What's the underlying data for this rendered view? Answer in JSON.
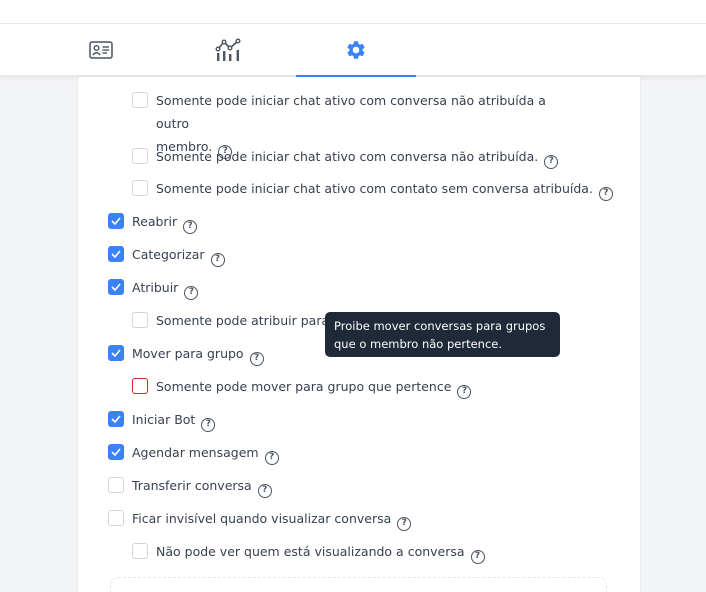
{
  "tabs": [
    {
      "icon": "contact-card-icon",
      "active": false
    },
    {
      "icon": "analytics-chart-icon",
      "active": false
    },
    {
      "icon": "gear-icon",
      "active": true
    }
  ],
  "colors": {
    "accent": "#3b82f6",
    "error": "#dc2626",
    "tooltip_bg": "#1f2937"
  },
  "permissions": [
    {
      "label_line1": "Somente pode iniciar chat ativo com conversa não atribuída a outro",
      "label_line2": "membro.",
      "checked": false
    },
    {
      "label": "Somente pode iniciar chat ativo com conversa não atribuída.",
      "checked": false
    },
    {
      "label": "Somente pode iniciar chat ativo com contato sem conversa atribuída.",
      "checked": false
    },
    {
      "label": "Reabrir",
      "checked": true
    },
    {
      "label": "Categorizar",
      "checked": true
    },
    {
      "label": "Atribuir",
      "checked": true
    },
    {
      "label": "Somente pode atribuir para c",
      "checked": false
    },
    {
      "label": "Mover para grupo",
      "checked": true
    },
    {
      "label": "Somente pode mover para grupo que pertence",
      "checked": false,
      "state": "error"
    },
    {
      "label": "Iniciar Bot",
      "checked": true
    },
    {
      "label": "Agendar mensagem",
      "checked": true
    },
    {
      "label": "Transferir conversa",
      "checked": false
    },
    {
      "label": "Ficar invisível quando visualizar conversa",
      "checked": false
    },
    {
      "label": "Não pode ver quem está visualizando a conversa",
      "checked": false
    }
  ],
  "tooltip": {
    "line1": "Proibe mover conversas para grupos",
    "line2": "que o membro não pertence."
  }
}
